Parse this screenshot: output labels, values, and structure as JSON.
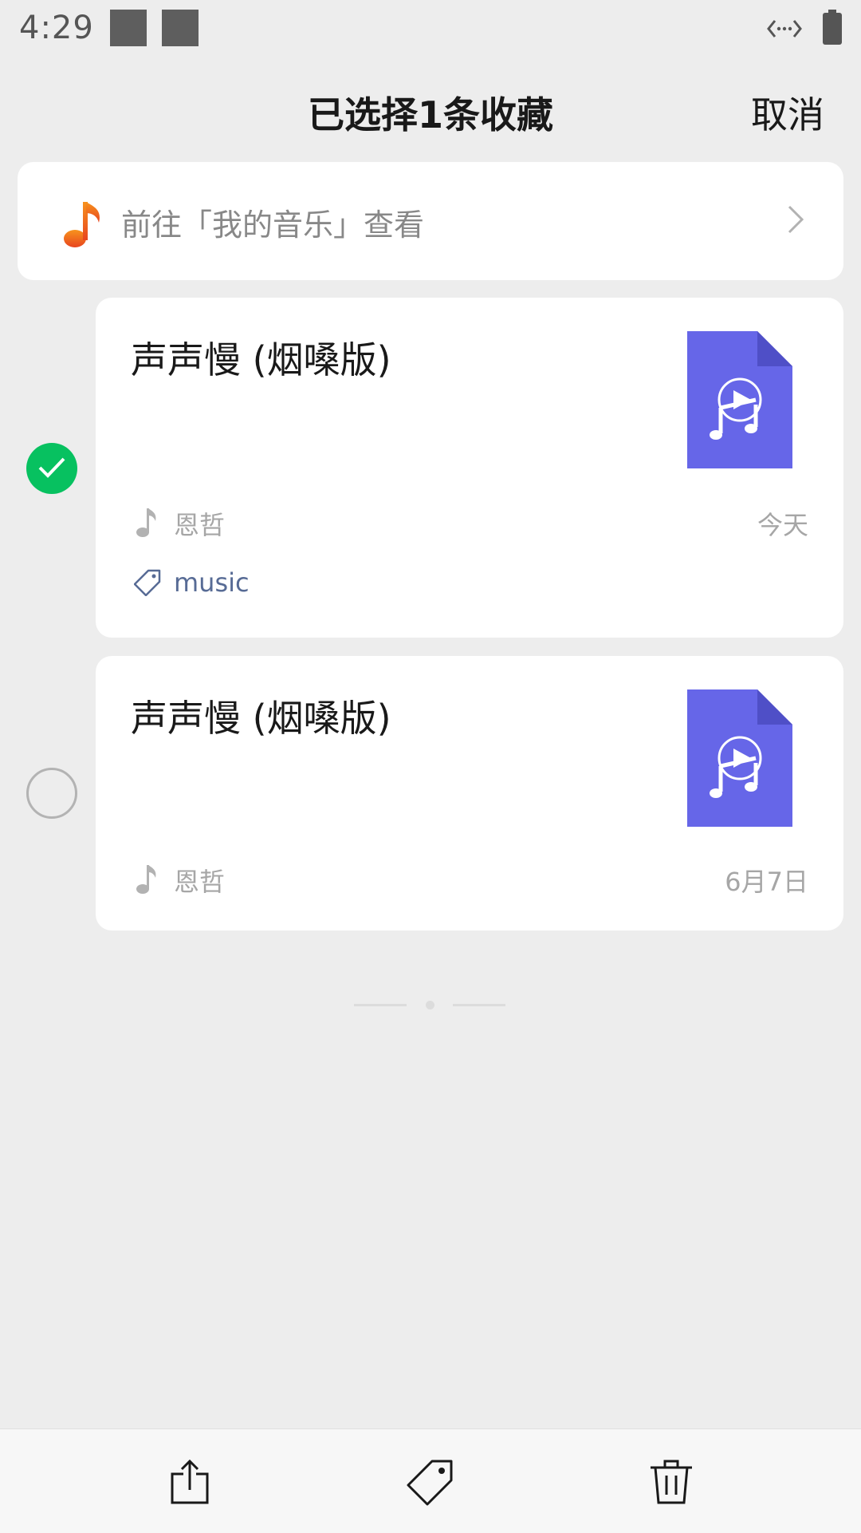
{
  "status_bar": {
    "time": "4:29"
  },
  "header": {
    "title": "已选择1条收藏",
    "cancel_label": "取消"
  },
  "banner": {
    "text": "前往「我的音乐」查看",
    "icon": "music-note-icon",
    "accent": "#f26b21"
  },
  "items": [
    {
      "title": "声声慢 (烟嗓版)",
      "author": "恩哲",
      "date": "今天",
      "tag": "music",
      "selected": true,
      "thumb_icon": "music-file-icon"
    },
    {
      "title": "声声慢 (烟嗓版)",
      "author": "恩哲",
      "date": "6月7日",
      "selected": false,
      "thumb_icon": "music-file-icon"
    }
  ],
  "toolbar": {
    "actions": [
      "share-icon",
      "tag-icon",
      "trash-icon"
    ]
  },
  "colors": {
    "selected": "#07c160",
    "file_icon": "#6666e8",
    "tag_text": "#576b95"
  }
}
